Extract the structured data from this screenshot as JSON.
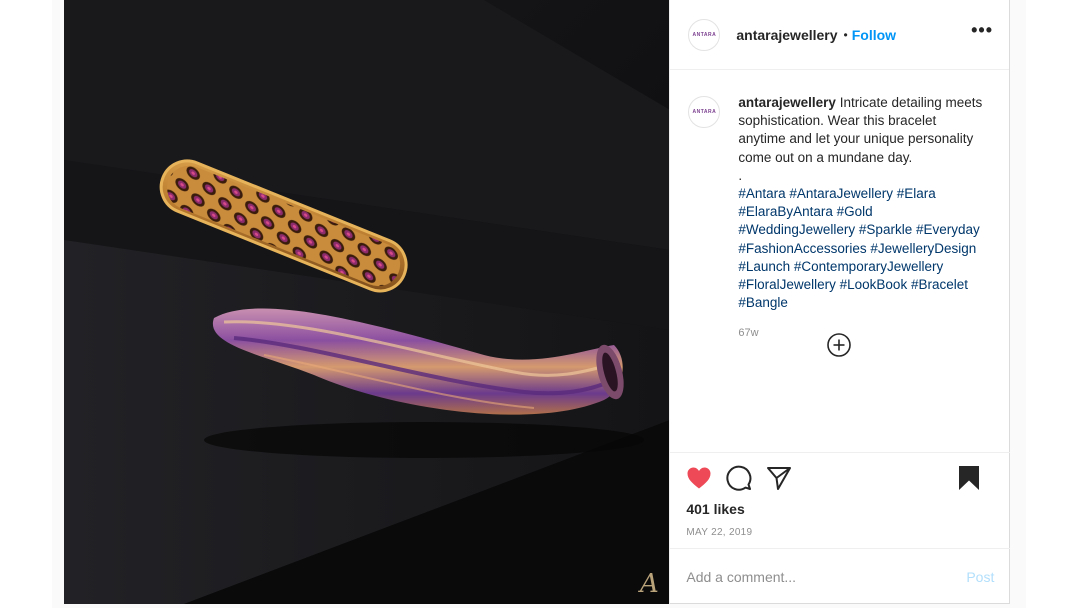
{
  "account": {
    "username": "antarajewellery",
    "avatar_text": "ANTARA",
    "follow_label": "Follow",
    "separator": "•"
  },
  "header": {
    "more_label": "•••"
  },
  "photo": {
    "watermark": "A"
  },
  "caption": {
    "username": "antarajewellery",
    "text": "Intricate detailing meets sophistication. Wear this bracelet anytime and let your unique personality come out on a mundane day.",
    "spacer": ".",
    "hashtags": "#Antara #AntaraJewellery #Elara #ElaraByAntara #Gold #WeddingJewellery #Sparkle #Everyday #FashionAccessories #JewelleryDesign #Launch #ContemporaryJewellery #FloralJewellery #LookBook #Bracelet #Bangle",
    "age": "67w"
  },
  "engagement": {
    "likes": "401 likes",
    "date": "MAY 22, 2019",
    "liked": true,
    "heart_color": "#ed4956"
  },
  "comment_input": {
    "placeholder": "Add a comment...",
    "post_label": "Post"
  },
  "icons": [
    "heart-icon",
    "comment-icon",
    "share-icon",
    "bookmark-icon",
    "more-options-icon",
    "load-more-comments-icon"
  ]
}
